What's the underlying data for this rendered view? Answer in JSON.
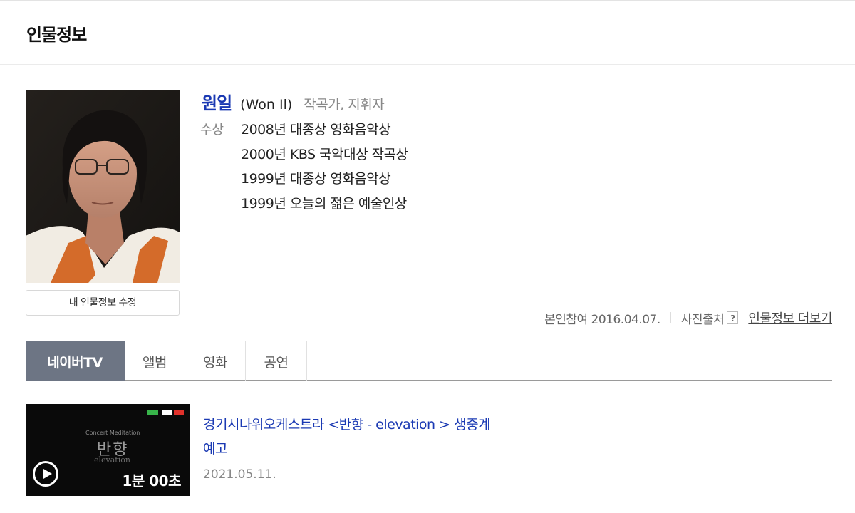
{
  "header": {
    "title": "인물정보"
  },
  "profile": {
    "name": "원일",
    "english_name": "(Won Il)",
    "occupation": "작곡가, 지휘자",
    "award_label": "수상",
    "awards": [
      "2008년 대종상 영화음악상",
      "2000년 KBS 국악대상 작곡상",
      "1999년 대종상 영화음악상",
      "1999년 오늘의 젊은 예술인상"
    ],
    "edit_button": "내 인물정보 수정"
  },
  "meta": {
    "self_participation": "본인참여 2016.04.07.",
    "photo_source": "사진출처",
    "help_icon": "?",
    "more_link": "인물정보 더보기"
  },
  "tabs": [
    {
      "label": "네이버TV",
      "active": true
    },
    {
      "label": "앨범",
      "active": false
    },
    {
      "label": "영화",
      "active": false
    },
    {
      "label": "공연",
      "active": false
    }
  ],
  "video": {
    "title": "경기시나위오케스트라 <반향 - elevation > 생중계 예고",
    "date": "2021.05.11.",
    "duration": "1분 00초",
    "thumb_subtitle": "Concert Meditation",
    "thumb_title": "반향",
    "thumb_english": "elevation"
  },
  "colors": {
    "name_blue": "#1a39b3",
    "active_tab_bg": "#6d7584"
  }
}
